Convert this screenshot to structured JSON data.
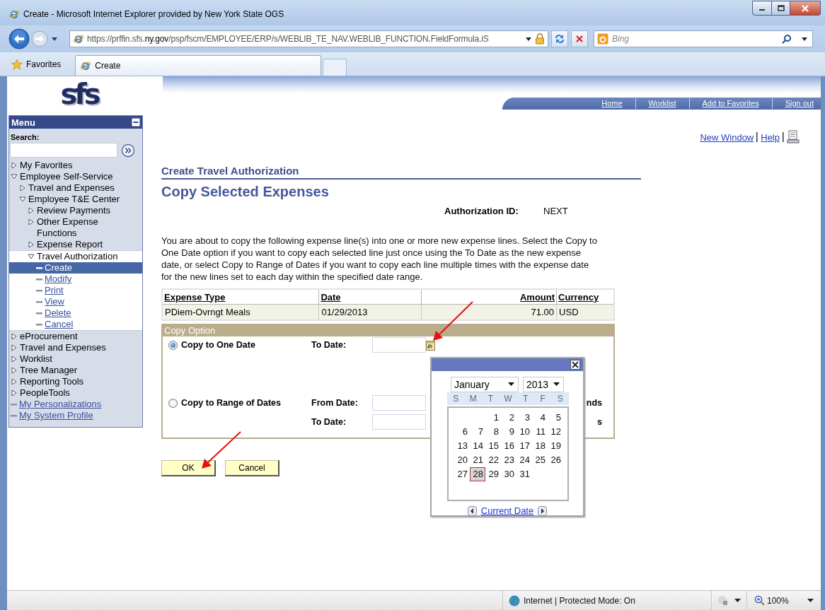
{
  "window": {
    "title": "Create - Microsoft Internet Explorer provided by New York State OGS"
  },
  "address_bar": {
    "url_prefix": "https://prffin.sfs.",
    "url_domain": "ny.gov",
    "url_path": "/psp/fscm/EMPLOYEE/ERP/s/WEBLIB_TE_NAV.WEBLIB_FUNCTION.FieldFormula.iS"
  },
  "search": {
    "placeholder": "Bing"
  },
  "favorites_button": "Favorites",
  "tabs": [
    {
      "label": "Create",
      "selected": true
    }
  ],
  "header": {
    "logo": "sfs",
    "links": [
      "Home",
      "Worklist",
      "Add to Favorites",
      "Sign out"
    ]
  },
  "menu": {
    "title": "Menu",
    "search_label": "Search:",
    "items": [
      {
        "label": "My Favorites",
        "kind": "folder",
        "expanded": false
      },
      {
        "label": "Employee Self-Service",
        "kind": "folder",
        "expanded": true,
        "children": [
          {
            "label": "Travel and Expenses",
            "kind": "folder",
            "expanded": false
          },
          {
            "label": "Employee T&E Center",
            "kind": "folder",
            "expanded": true,
            "children": [
              {
                "label": "Review Payments",
                "kind": "folder",
                "expanded": false,
                "active": false
              },
              {
                "label": "Other Expense Functions",
                "kind": "folder",
                "expanded": false,
                "active": false
              },
              {
                "label": "Expense Report",
                "kind": "folder",
                "expanded": false,
                "active": false
              },
              {
                "label": "Travel Authorization",
                "kind": "folder",
                "expanded": true,
                "active": true,
                "children": [
                  {
                    "label": "Create",
                    "kind": "link",
                    "selected": true
                  },
                  {
                    "label": "Modify",
                    "kind": "link",
                    "selected": false
                  },
                  {
                    "label": "Print",
                    "kind": "link",
                    "selected": false
                  },
                  {
                    "label": "View",
                    "kind": "link",
                    "selected": false
                  },
                  {
                    "label": "Delete",
                    "kind": "link",
                    "selected": false
                  },
                  {
                    "label": "Cancel",
                    "kind": "link",
                    "selected": false
                  }
                ]
              }
            ]
          }
        ]
      },
      {
        "label": "eProcurement",
        "kind": "folder",
        "expanded": false
      },
      {
        "label": "Travel and Expenses",
        "kind": "folder",
        "expanded": false
      },
      {
        "label": "Worklist",
        "kind": "folder",
        "expanded": false
      },
      {
        "label": "Tree Manager",
        "kind": "folder",
        "expanded": false
      },
      {
        "label": "Reporting Tools",
        "kind": "folder",
        "expanded": false
      },
      {
        "label": "PeopleTools",
        "kind": "folder",
        "expanded": false
      },
      {
        "label": "My Personalizations",
        "kind": "link",
        "selected": false
      },
      {
        "label": "My System Profile",
        "kind": "link",
        "selected": false
      }
    ]
  },
  "page": {
    "links": [
      "New Window",
      "Help"
    ],
    "section_title": "Create Travel Authorization",
    "title": "Copy Selected Expenses",
    "id_label": "Authorization ID:",
    "id_value": "NEXT",
    "instructions": "You are about to copy the following expense line(s) into one or more new expense lines. Select the Copy to One Date option if you want to copy each selected line just once using the To Date as the new expense date, or select Copy to Range of Dates if you want to copy each line multiple times with the expense date for the new lines set to each day within the specified date range.",
    "table": {
      "columns": [
        "Expense Type",
        "Date",
        "Amount",
        "Currency"
      ],
      "rows": [
        [
          "PDiem-Ovrngt Meals",
          "01/29/2013",
          "71.00",
          "USD"
        ]
      ]
    },
    "copy_option": {
      "title": "Copy Option",
      "options": [
        {
          "label": "Copy to One Date",
          "selected": true,
          "fields": [
            {
              "label": "To Date:",
              "calendar_button": true
            }
          ]
        },
        {
          "label": "Copy to Range of Dates",
          "selected": false,
          "fields": [
            {
              "label": "From Date:",
              "calendar_button": false,
              "trailing": "nds"
            },
            {
              "label": "To Date:",
              "calendar_button": false,
              "trailing": "s"
            }
          ]
        }
      ]
    },
    "buttons": [
      "OK",
      "Cancel"
    ]
  },
  "calendar": {
    "month": "January",
    "year": "2013",
    "weekdays": [
      "S",
      "M",
      "T",
      "W",
      "T",
      "F",
      "S"
    ],
    "weeks": [
      [
        {
          "label": "1",
          "selected": false
        },
        {
          "label": "2",
          "selected": false
        },
        {
          "label": "3",
          "selected": false
        },
        {
          "label": "4",
          "selected": false
        },
        {
          "label": "5",
          "selected": false
        }
      ],
      [
        {
          "label": "6",
          "selected": false
        },
        {
          "label": "7",
          "selected": false
        },
        {
          "label": "8",
          "selected": false
        },
        {
          "label": "9",
          "selected": false
        },
        {
          "label": "10",
          "selected": false
        },
        {
          "label": "11",
          "selected": false
        },
        {
          "label": "12",
          "selected": false
        }
      ],
      [
        {
          "label": "13",
          "selected": false
        },
        {
          "label": "14",
          "selected": false
        },
        {
          "label": "15",
          "selected": false
        },
        {
          "label": "16",
          "selected": false
        },
        {
          "label": "17",
          "selected": false
        },
        {
          "label": "18",
          "selected": false
        },
        {
          "label": "19",
          "selected": false
        }
      ],
      [
        {
          "label": "20",
          "selected": false
        },
        {
          "label": "21",
          "selected": false
        },
        {
          "label": "22",
          "selected": false
        },
        {
          "label": "23",
          "selected": false
        },
        {
          "label": "24",
          "selected": false
        },
        {
          "label": "25",
          "selected": false
        },
        {
          "label": "26",
          "selected": false
        }
      ],
      [
        {
          "label": "27",
          "selected": false
        },
        {
          "label": "28",
          "selected": true
        },
        {
          "label": "29",
          "selected": false
        },
        {
          "label": "30",
          "selected": false
        },
        {
          "label": "31",
          "selected": false
        }
      ]
    ],
    "footer_link": "Current Date"
  },
  "status_bar": {
    "zone": "Internet | Protected Mode: On",
    "zoom": "100%"
  }
}
